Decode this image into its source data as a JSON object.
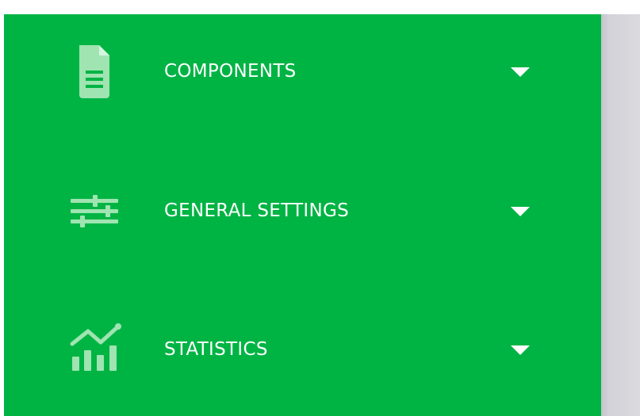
{
  "sidebar": {
    "background_color": "#00b444",
    "icon_color": "#9fe4b1",
    "items": [
      {
        "label": "COMPONENTS",
        "icon": "document-icon"
      },
      {
        "label": "GENERAL SETTINGS",
        "icon": "sliders-icon"
      },
      {
        "label": "STATISTICS",
        "icon": "chart-icon"
      }
    ]
  }
}
